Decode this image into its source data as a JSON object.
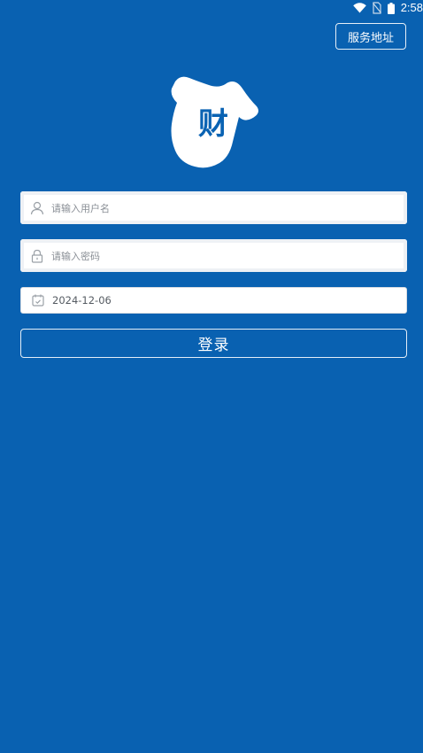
{
  "status_bar": {
    "time": "2:58",
    "icons": [
      "wifi-icon",
      "sim-no-signal-icon",
      "battery-icon"
    ]
  },
  "header": {
    "service_button_label": "服务地址"
  },
  "logo": {
    "text": "财",
    "name": "logo-icon"
  },
  "form": {
    "username": {
      "placeholder": "请输入用户名",
      "icon": "user-icon"
    },
    "password": {
      "placeholder": "请输入密码",
      "icon": "lock-icon"
    },
    "date": {
      "value": "2024-12-06",
      "icon": "calendar-icon"
    },
    "login_label": "登录"
  },
  "colors": {
    "background": "#0961b1",
    "field_background": "#ffffff",
    "text_white": "#ffffff"
  }
}
